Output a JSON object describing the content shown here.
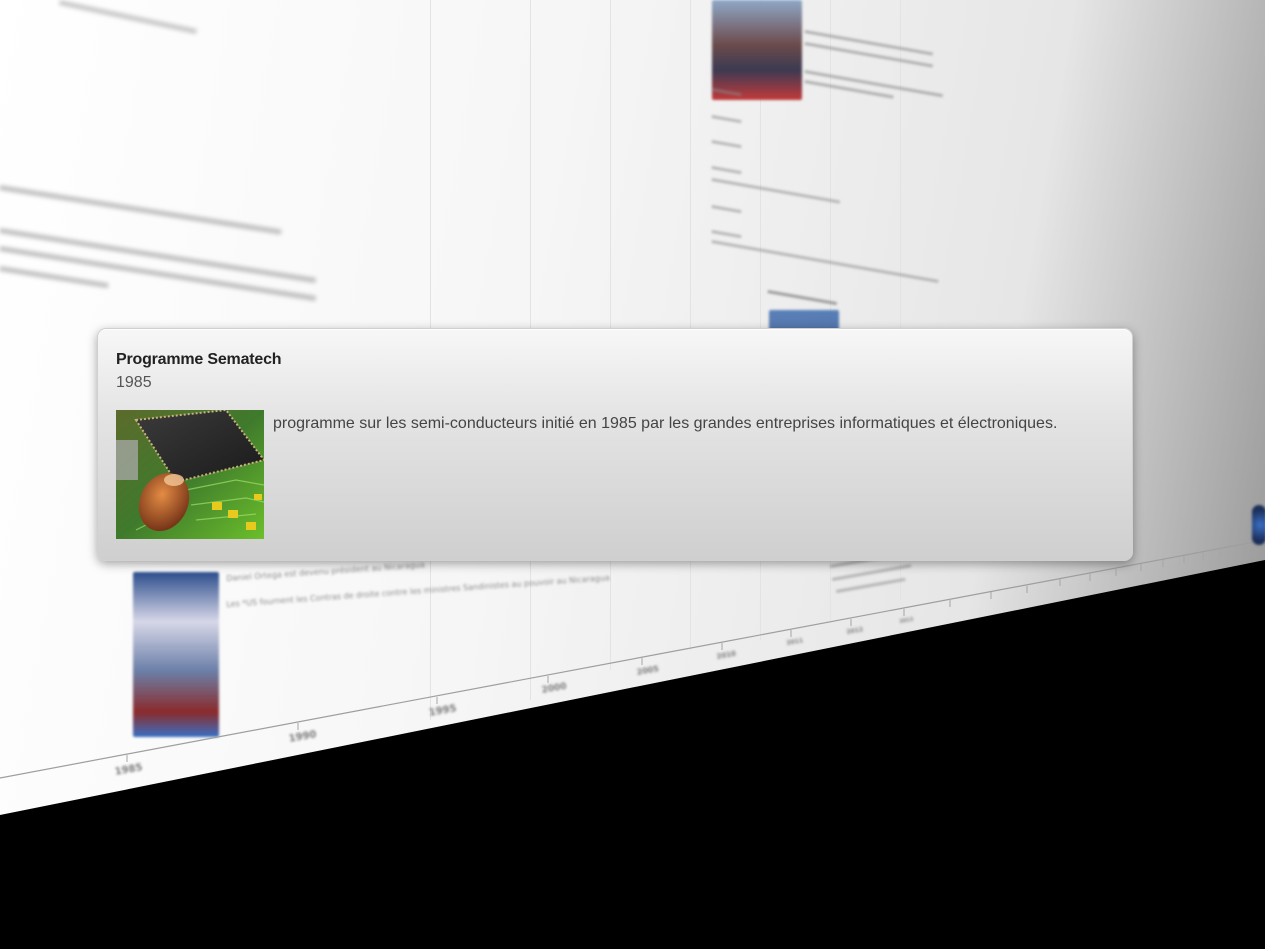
{
  "timeline": {
    "years": [
      "1985",
      "1990",
      "1995",
      "2000",
      "2005",
      "2010",
      "2011",
      "2012",
      "2013"
    ]
  },
  "card": {
    "title": "Programme Sematech",
    "year": "1985",
    "description": "programme sur les semi-conducteurs initié en 1985 par les grandes entreprises informatiques et électroniques.",
    "thumbnail_icon": "circuit-board-photo"
  },
  "background": {
    "ghost_lines": [
      "Daniel Ortega est devenu président au Nicaragua",
      "Les *US fournent les Contras de droite contre les ministres Sandinistes au pouvoir au Nicaragua"
    ]
  },
  "colors": {
    "card_top": "#f7f7f7",
    "card_bottom": "#cfcfcf",
    "accent_flag": "#3a6fc4"
  }
}
